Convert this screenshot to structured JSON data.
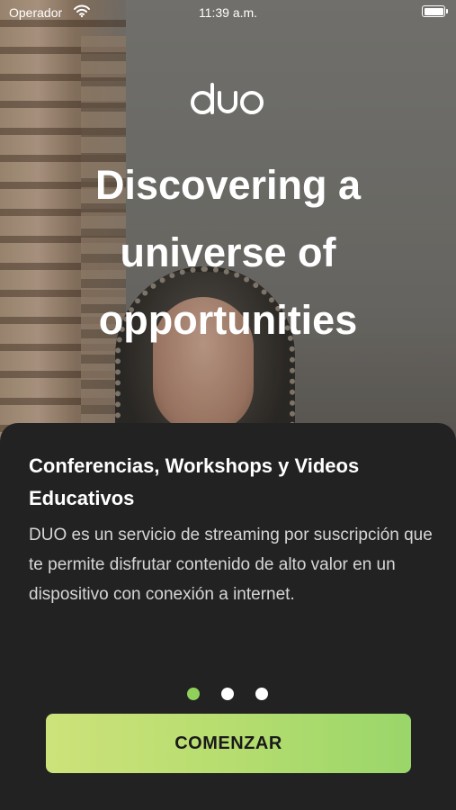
{
  "status_bar": {
    "carrier": "Operador",
    "time": "11:39 a.m.",
    "icons": [
      "wifi-icon",
      "battery-icon"
    ]
  },
  "brand": {
    "logo_text": "duo"
  },
  "hero": {
    "headline_lines": [
      "Discovering a",
      "universe of",
      "opportunities"
    ]
  },
  "onboarding": {
    "title": "Conferencias, Workshops y Videos Educativos",
    "description": "DUO es un servicio de streaming por suscripción que te permite disfrutar contenido de alto valor en un dispositivo con conexión a internet.",
    "page_count": 3,
    "active_page": 1,
    "cta_label": "COMENZAR"
  },
  "colors": {
    "accent_green": "#8fd15a",
    "cta_gradient_start": "#cde27a",
    "cta_gradient_end": "#9ad66a",
    "sheet_background": "#222222"
  }
}
